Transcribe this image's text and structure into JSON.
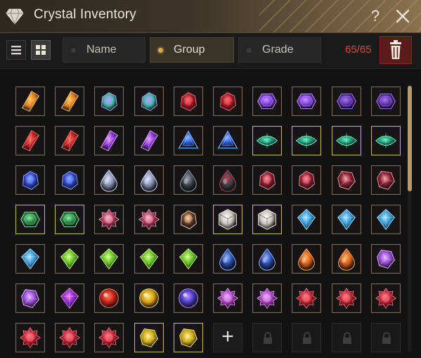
{
  "window": {
    "title": "Crystal Inventory",
    "help_label": "?",
    "accent": "#d7a64f"
  },
  "toolbar": {
    "view_modes": [
      {
        "name": "list-view",
        "icon": "list-icon",
        "active": false
      },
      {
        "name": "grid-view",
        "icon": "grid-icon",
        "active": true
      }
    ],
    "sort_options": [
      {
        "label": "Name",
        "active": false
      },
      {
        "label": "Group",
        "active": true
      },
      {
        "label": "Grade",
        "active": false
      }
    ],
    "capacity": "65/65",
    "capacity_color": "#d24a3f",
    "delete_icon": "trash-icon"
  },
  "grid": {
    "columns": 10,
    "rows": [
      [
        {
          "item": "amber-shard",
          "color": "#e07a1c",
          "glow": "#ffc45a"
        },
        {
          "item": "amber-shard",
          "color": "#e07a1c",
          "glow": "#ffc45a"
        },
        {
          "item": "teal-cluster",
          "color": "#3bb5a0",
          "glow": "#b3a2ff"
        },
        {
          "item": "teal-cluster",
          "color": "#3bb5a0",
          "glow": "#b3a2ff"
        },
        {
          "item": "ruby-chunk",
          "color": "#a51826",
          "glow": "#ff6b73"
        },
        {
          "item": "ruby-chunk",
          "color": "#a51826",
          "glow": "#ff6b73"
        },
        {
          "item": "violet-hexagon",
          "color": "#7a38d6",
          "glow": "#c79bff"
        },
        {
          "item": "violet-hexagon",
          "color": "#7a38d6",
          "glow": "#c79bff"
        },
        {
          "item": "violet-hexagon-dark",
          "color": "#5b2aa8",
          "glow": "#a57fe8"
        },
        {
          "item": "violet-hexagon-dark",
          "color": "#5b2aa8",
          "glow": "#a57fe8"
        }
      ],
      [
        {
          "item": "crimson-shard",
          "color": "#c21d22",
          "glow": "#ff6a5a"
        },
        {
          "item": "crimson-shard",
          "color": "#c21d22",
          "glow": "#ff6a5a"
        },
        {
          "item": "purple-shard",
          "color": "#8b2fd9",
          "glow": "#e09cff"
        },
        {
          "item": "purple-shard",
          "color": "#8b2fd9",
          "glow": "#e09cff"
        },
        {
          "item": "sapphire-triangle",
          "color": "#1d48c4",
          "glow": "#7fb4ff"
        },
        {
          "item": "sapphire-triangle",
          "color": "#1d48c4",
          "glow": "#7fb4ff"
        },
        {
          "item": "emerald-eye",
          "color": "#138f6c",
          "glow": "#6ff2c3",
          "gold": true
        },
        {
          "item": "emerald-eye",
          "color": "#138f6c",
          "glow": "#6ff2c3",
          "gold": true
        },
        {
          "item": "emerald-eye",
          "color": "#138f6c",
          "glow": "#6ff2c3",
          "gold": true
        },
        {
          "item": "emerald-eye",
          "color": "#138f6c",
          "glow": "#6ff2c3",
          "gold": true
        }
      ],
      [
        {
          "item": "blue-cluster",
          "color": "#2c44c9",
          "glow": "#8da7ff"
        },
        {
          "item": "blue-cluster",
          "color": "#2c44c9",
          "glow": "#8da7ff"
        },
        {
          "item": "silver-drop",
          "color": "#7e8aa8",
          "glow": "#dbe4ff"
        },
        {
          "item": "silver-drop",
          "color": "#7e8aa8",
          "glow": "#dbe4ff"
        },
        {
          "item": "dark-egg",
          "color": "#3a4048",
          "glow": "#9aa6b8"
        },
        {
          "item": "dark-egg",
          "color": "#3a4048",
          "glow": "#c24050"
        },
        {
          "item": "garnet-pair",
          "color": "#8a1c2c",
          "glow": "#ff8a9a"
        },
        {
          "item": "garnet-pair",
          "color": "#8a1c2c",
          "glow": "#ff8a9a"
        },
        {
          "item": "garnet-stone",
          "color": "#7a1a2a",
          "glow": "#ff9aa8"
        },
        {
          "item": "garnet-stone",
          "color": "#7a1a2a",
          "glow": "#ff9aa8"
        }
      ],
      [
        {
          "item": "jade-octagon",
          "color": "#1f7a3a",
          "glow": "#8ff0a8",
          "gold": true
        },
        {
          "item": "jade-octagon",
          "color": "#1f7a3a",
          "glow": "#8ff0a8",
          "gold": true
        },
        {
          "item": "rose-prism",
          "color": "#9a2a4c",
          "glow": "#ffb3c8"
        },
        {
          "item": "rose-prism",
          "color": "#9a2a4c",
          "glow": "#ffb3c8"
        },
        {
          "item": "amber-onyx",
          "color": "#5a3a2a",
          "glow": "#ffd39a"
        },
        {
          "item": "diamond-cube",
          "color": "#c9c4bd",
          "glow": "#ffffff",
          "gold": true
        },
        {
          "item": "diamond-cube",
          "color": "#c9c4bd",
          "glow": "#ffffff",
          "gold": true
        },
        {
          "item": "azure-kite",
          "color": "#2a8fd0",
          "glow": "#a9e6ff"
        },
        {
          "item": "azure-kite",
          "color": "#2a8fd0",
          "glow": "#a9e6ff"
        },
        {
          "item": "azure-kite",
          "color": "#2a8fd0",
          "glow": "#a9e6ff"
        }
      ],
      [
        {
          "item": "azure-kite",
          "color": "#2a8fd0",
          "glow": "#a9e6ff"
        },
        {
          "item": "lime-kite",
          "color": "#55b81c",
          "glow": "#d4ff7a"
        },
        {
          "item": "lime-kite",
          "color": "#55b81c",
          "glow": "#d4ff7a"
        },
        {
          "item": "lime-kite",
          "color": "#55b81c",
          "glow": "#d4ff7a"
        },
        {
          "item": "lime-kite",
          "color": "#55b81c",
          "glow": "#d4ff7a"
        },
        {
          "item": "cobalt-drop",
          "color": "#2447a8",
          "glow": "#9ab8ff"
        },
        {
          "item": "cobalt-drop",
          "color": "#2447a8",
          "glow": "#9ab8ff"
        },
        {
          "item": "fire-teardrop",
          "color": "#d05a14",
          "glow": "#ffb36a"
        },
        {
          "item": "fire-teardrop",
          "color": "#d05a14",
          "glow": "#ffb36a"
        },
        {
          "item": "amethyst-gem",
          "color": "#9044d0",
          "glow": "#e8b8ff"
        }
      ],
      [
        {
          "item": "amethyst-gem",
          "color": "#9044d0",
          "glow": "#e8b8ff"
        },
        {
          "item": "purple-trillion",
          "color": "#7a22c8",
          "glow": "#ff7af0"
        },
        {
          "item": "red-orb",
          "color": "#c4201a",
          "glow": "#ff8a5a"
        },
        {
          "item": "gold-orb",
          "color": "#d49a14",
          "glow": "#fff07a"
        },
        {
          "item": "indigo-orb",
          "color": "#4a3ac4",
          "glow": "#c29aff"
        },
        {
          "item": "orchid-rose",
          "color": "#9a3ab0",
          "glow": "#f0a8ff"
        },
        {
          "item": "orchid-rose",
          "color": "#9a3ab0",
          "glow": "#f0a8ff"
        },
        {
          "item": "scarlet-star",
          "color": "#b01c2a",
          "glow": "#ff7a8a"
        },
        {
          "item": "scarlet-star",
          "color": "#b01c2a",
          "glow": "#ff7a8a"
        },
        {
          "item": "scarlet-star",
          "color": "#b01c2a",
          "glow": "#ff7a8a"
        }
      ],
      [
        {
          "item": "scarlet-star",
          "color": "#b01c2a",
          "glow": "#ff7a8a"
        },
        {
          "item": "scarlet-star",
          "color": "#b01c2a",
          "glow": "#ff7a8a"
        },
        {
          "item": "scarlet-star",
          "color": "#b01c2a",
          "glow": "#ff7a8a"
        },
        {
          "item": "topaz-gem",
          "color": "#c9a414",
          "glow": "#fff38a",
          "gold": true
        },
        {
          "item": "topaz-gem",
          "color": "#c9a414",
          "glow": "#fff38a",
          "gold": true
        },
        {
          "item": "add-slot",
          "type": "add",
          "icon": "plus-icon",
          "label": "+"
        },
        {
          "item": "locked-slot",
          "type": "locked",
          "icon": "lock-icon"
        },
        {
          "item": "locked-slot",
          "type": "locked",
          "icon": "lock-icon"
        },
        {
          "item": "locked-slot",
          "type": "locked",
          "icon": "lock-icon"
        },
        {
          "item": "locked-slot",
          "type": "locked",
          "icon": "lock-icon"
        }
      ]
    ]
  }
}
